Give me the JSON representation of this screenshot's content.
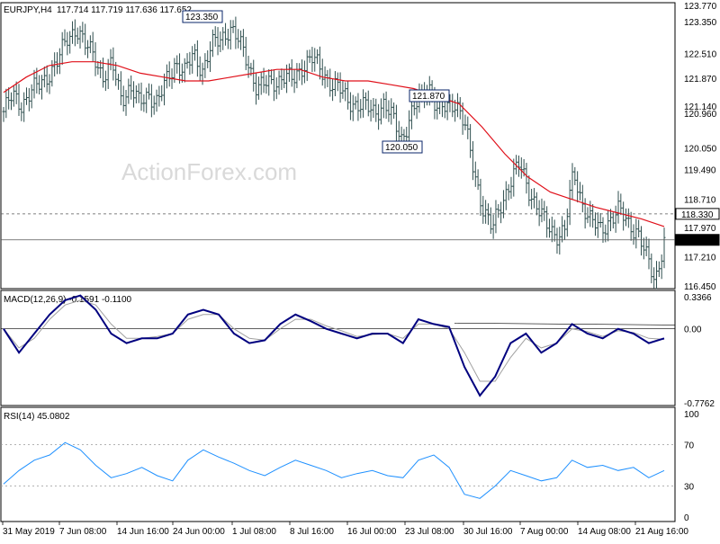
{
  "chart_data": [
    {
      "type": "candlestick",
      "pane": "price",
      "symbol_timeframe": "EURJPY,H4",
      "ohlc_header": "117.714 117.719 117.636 117.652",
      "current_price": "117.652",
      "ylim": [
        116.45,
        123.77
      ],
      "y_ticks": [
        "123.770",
        "123.350",
        "122.510",
        "121.870",
        "121.140",
        "120.960",
        "120.050",
        "119.490",
        "118.710",
        "118.330",
        "117.970",
        "117.210",
        "116.450"
      ],
      "annotations": [
        {
          "label": "123.350",
          "x": "28 Jun 2019",
          "price": 123.35
        },
        {
          "label": "121.870",
          "x": "26 Jul 2019",
          "price": 121.87
        },
        {
          "label": "120.050",
          "x": "24 Jul 2019",
          "price": 120.05
        }
      ],
      "horizontal_levels": [
        {
          "label": "118.330",
          "price": 118.33,
          "style": "dashed"
        },
        {
          "label": "117.652",
          "price": 117.652,
          "style": "solid"
        }
      ],
      "watermark": "ActionForex.com",
      "bar_color": "#2f4f4f",
      "ma_color": "#e0101a",
      "close_path": [
        [
          "31 May 00:00",
          121.0
        ],
        [
          "31 May 12:00",
          121.4
        ],
        [
          "2 Jun",
          121.2
        ],
        [
          "3 Jun",
          121.5
        ],
        [
          "4 Jun",
          121.7
        ],
        [
          "5 Jun",
          122.0
        ],
        [
          "6 Jun",
          122.3
        ],
        [
          "7 Jun",
          122.9
        ],
        [
          "7 Jun 08:00",
          123.2
        ],
        [
          "8 Jun",
          122.7
        ],
        [
          "10 Jun",
          122.5
        ],
        [
          "11 Jun",
          121.9
        ],
        [
          "12 Jun",
          122.2
        ],
        [
          "13 Jun",
          121.4
        ],
        [
          "14 Jun",
          121.6
        ],
        [
          "14 Jun 16:00",
          121.2
        ],
        [
          "17 Jun",
          121.5
        ],
        [
          "18 Jun",
          121.2
        ],
        [
          "19 Jun",
          121.8
        ],
        [
          "20 Jun",
          122.3
        ],
        [
          "21 Jun",
          122.0
        ],
        [
          "24 Jun",
          122.5
        ],
        [
          "25 Jun",
          122.1
        ],
        [
          "26 Jun",
          122.7
        ],
        [
          "27 Jun",
          122.9
        ],
        [
          "28 Jun",
          123.2
        ],
        [
          "1 Jul",
          122.8
        ],
        [
          "2 Jul",
          122.3
        ],
        [
          "2 Jul 12:00",
          121.6
        ],
        [
          "3 Jul",
          121.7
        ],
        [
          "4 Jul",
          121.8
        ],
        [
          "5 Jul",
          121.9
        ],
        [
          "6 Jul",
          121.8
        ],
        [
          "8 Jul",
          122.2
        ],
        [
          "9 Jul",
          122.4
        ],
        [
          "10 Jul",
          122.1
        ],
        [
          "11 Jul",
          121.8
        ],
        [
          "12 Jul",
          121.6
        ],
        [
          "15 Jul",
          121.3
        ],
        [
          "16 Jul",
          121.2
        ],
        [
          "17 Jul",
          121.1
        ],
        [
          "18 Jul",
          121.0
        ],
        [
          "19 Jul",
          121.2
        ],
        [
          "22 Jul",
          120.8
        ],
        [
          "23 Jul",
          120.3
        ],
        [
          "24 Jul",
          120.9
        ],
        [
          "25 Jul",
          121.3
        ],
        [
          "26 Jul",
          121.7
        ],
        [
          "29 Jul",
          121.0
        ],
        [
          "30 Jul",
          121.1
        ],
        [
          "31 Jul",
          121.3
        ],
        [
          "1 Aug",
          120.6
        ],
        [
          "2 Aug",
          119.4
        ],
        [
          "3 Aug",
          118.5
        ],
        [
          "5 Aug",
          117.9
        ],
        [
          "5 Aug 12:00",
          118.6
        ],
        [
          "6 Aug",
          119.2
        ],
        [
          "7 Aug",
          119.6
        ],
        [
          "8 Aug",
          119.0
        ],
        [
          "9 Aug",
          118.5
        ],
        [
          "12 Aug",
          118.0
        ],
        [
          "13 Aug",
          117.8
        ],
        [
          "14 Aug",
          117.9
        ],
        [
          "14 Aug 08:00",
          119.4
        ],
        [
          "15 Aug",
          118.6
        ],
        [
          "16 Aug",
          118.1
        ],
        [
          "17 Aug",
          117.9
        ],
        [
          "19 Aug",
          118.2
        ],
        [
          "20 Aug",
          118.4
        ],
        [
          "21 Aug",
          118.1
        ],
        [
          "21 Aug 16:00",
          117.9
        ],
        [
          "22 Aug",
          117.2
        ],
        [
          "23 Aug",
          116.6
        ],
        [
          "23 Aug 08:00",
          117.652
        ]
      ],
      "ma_path": [
        121.5,
        121.9,
        122.2,
        122.3,
        122.3,
        122.2,
        122.0,
        121.9,
        121.8,
        121.8,
        121.9,
        122.0,
        122.1,
        122.1,
        121.9,
        121.8,
        121.8,
        121.7,
        121.6,
        121.4,
        121.2,
        120.6,
        119.9,
        119.3,
        118.9,
        118.7,
        118.5,
        118.35,
        118.2,
        118.0
      ]
    },
    {
      "type": "line",
      "pane": "macd",
      "label": "MACD(12,26,9) -0.1591 -0.1100",
      "ylim": [
        -0.7762,
        0.3366
      ],
      "y_ticks": [
        "0.3366",
        "0.00",
        "-0.7762"
      ],
      "series": [
        {
          "name": "MACD",
          "color": "#00007f",
          "values": [
            0.0,
            -0.25,
            -0.05,
            0.15,
            0.3,
            0.35,
            0.2,
            -0.05,
            -0.15,
            -0.1,
            -0.1,
            -0.05,
            0.15,
            0.2,
            0.15,
            -0.05,
            -0.15,
            -0.12,
            0.05,
            0.15,
            0.08,
            0.0,
            -0.05,
            -0.1,
            -0.05,
            -0.05,
            -0.15,
            0.1,
            0.05,
            0.02,
            -0.4,
            -0.7,
            -0.5,
            -0.15,
            -0.05,
            -0.25,
            -0.15,
            0.05,
            -0.05,
            -0.1,
            0.0,
            -0.05,
            -0.15,
            -0.1
          ]
        },
        {
          "name": "Signal",
          "color": "#a0a0a0",
          "values": [
            0.0,
            -0.2,
            -0.1,
            0.1,
            0.25,
            0.3,
            0.25,
            0.05,
            -0.1,
            -0.1,
            -0.08,
            -0.05,
            0.1,
            0.15,
            0.15,
            0.0,
            -0.1,
            -0.12,
            0.0,
            0.1,
            0.1,
            0.03,
            -0.02,
            -0.08,
            -0.06,
            -0.05,
            -0.1,
            0.05,
            0.05,
            0.0,
            -0.25,
            -0.55,
            -0.55,
            -0.3,
            -0.1,
            -0.2,
            -0.15,
            0.0,
            -0.03,
            -0.08,
            -0.02,
            -0.04,
            -0.1,
            -0.11
          ]
        }
      ]
    },
    {
      "type": "line",
      "pane": "rsi",
      "label": "RSI(14) 45.0802",
      "ylim": [
        0,
        100
      ],
      "y_ticks": [
        "100",
        "70",
        "30",
        "0"
      ],
      "series": [
        {
          "name": "RSI",
          "color": "#1e90ff",
          "values": [
            32,
            45,
            55,
            60,
            72,
            65,
            50,
            38,
            42,
            48,
            40,
            35,
            55,
            65,
            58,
            52,
            45,
            40,
            48,
            55,
            50,
            45,
            38,
            42,
            45,
            40,
            38,
            55,
            60,
            48,
            22,
            18,
            30,
            45,
            40,
            35,
            38,
            55,
            48,
            50,
            45,
            48,
            38,
            45
          ]
        }
      ]
    }
  ],
  "x_axis": {
    "tick_labels": [
      "31 May 2019",
      "7 Jun 08:00",
      "14 Jun 16:00",
      "24 Jun 00:00",
      "1 Jul 08:00",
      "8 Jul 16:00",
      "16 Jul 00:00",
      "23 Jul 08:00",
      "30 Jul 16:00",
      "7 Aug 00:00",
      "14 Aug 08:00",
      "21 Aug 16:00"
    ]
  }
}
